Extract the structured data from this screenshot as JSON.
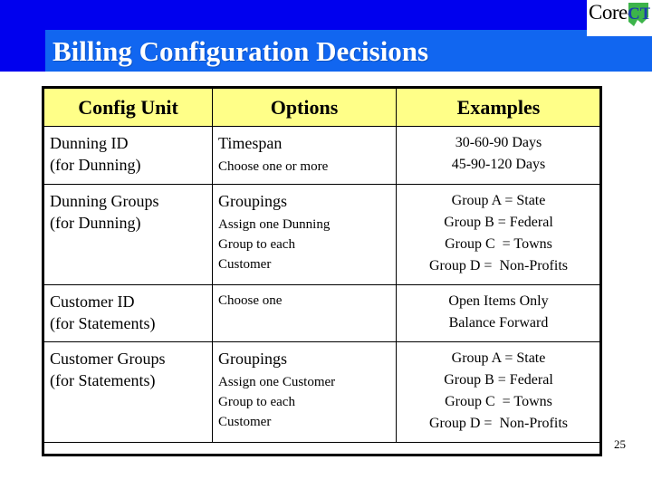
{
  "slide": {
    "title": "Billing Configuration Decisions",
    "number": "25"
  },
  "logo": {
    "text": "Core-",
    "mark": "ct-state-outline-icon",
    "mark_letters": "CT",
    "colors": {
      "letters": "#1a3faa",
      "state": "#3cb44a"
    }
  },
  "colors": {
    "banner_dark": "#0000ee",
    "banner_light": "#1166f0",
    "title_text": "#ffffff",
    "header_fill": "#ffff88",
    "border": "#000000"
  },
  "table": {
    "headers": [
      "Config Unit",
      "Options",
      "Examples"
    ],
    "rows": [
      {
        "config_unit": [
          "Dunning ID",
          "(for Dunning)"
        ],
        "options_main": "Timespan",
        "options_sub": [
          "Choose one or more"
        ],
        "examples": [
          "30-60-90 Days",
          "45-90-120 Days"
        ]
      },
      {
        "config_unit": [
          "Dunning Groups",
          "(for Dunning)"
        ],
        "options_main": "Groupings",
        "options_sub": [
          "Assign one Dunning",
          "Group to each",
          "Customer"
        ],
        "examples": [
          "Group A = State",
          "Group B = Federal",
          "Group C  = Towns",
          "Group D =  Non-Profits"
        ]
      },
      {
        "config_unit": [
          "Customer ID",
          "(for Statements)"
        ],
        "options_main": "",
        "options_sub": [
          "Choose one"
        ],
        "examples": [
          "Open Items Only",
          "Balance Forward"
        ]
      },
      {
        "config_unit": [
          "Customer Groups",
          "(for Statements)"
        ],
        "options_main": "Groupings",
        "options_sub": [
          "Assign one Customer",
          "Group to each",
          "Customer"
        ],
        "examples": [
          "Group A = State",
          "Group B = Federal",
          "Group C  = Towns",
          "Group D =  Non-Profits"
        ]
      }
    ]
  }
}
